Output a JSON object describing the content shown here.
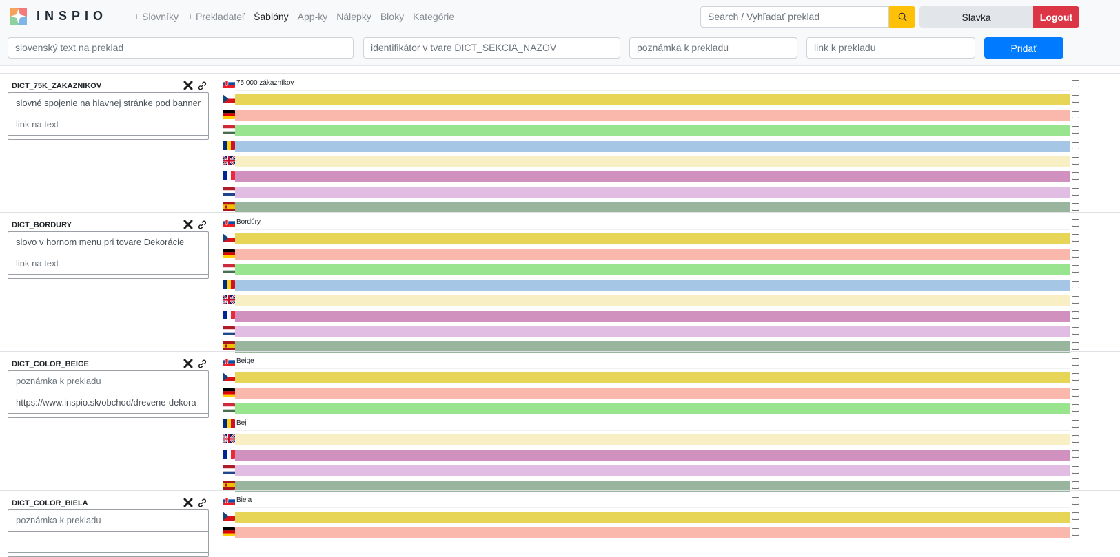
{
  "app": {
    "logo_text": "INSPIO",
    "nav": [
      {
        "label": "+ Slovníky",
        "active": false
      },
      {
        "label": "+ Prekladateľ",
        "active": false
      },
      {
        "label": "Šablóny",
        "active": true
      },
      {
        "label": "App-ky",
        "active": false
      },
      {
        "label": "Nálepky",
        "active": false
      },
      {
        "label": "Bloky",
        "active": false
      },
      {
        "label": "Kategórie",
        "active": false
      }
    ],
    "search_placeholder": "Search / Vyhľadať preklad",
    "user_label": "Slavka",
    "logout_label": "Logout"
  },
  "add_form": {
    "text_placeholder": "slovenský text na preklad",
    "id_placeholder": "identifikátor v tvare DICT_SEKCIA_NAZOV",
    "note_placeholder": "poznámka k prekladu",
    "link_placeholder": "link k prekladu",
    "submit_label": "Pridať"
  },
  "languages": [
    "sk",
    "cz",
    "de",
    "hu",
    "ro",
    "gb",
    "fr",
    "nl",
    "es"
  ],
  "lang_colors": {
    "sk": "#ffffff",
    "cz": "#e6d557",
    "de": "#f9b8ab",
    "hu": "#98e48f",
    "ro": "#a5c7e5",
    "gb": "#f8efc5",
    "fr": "#d191bf",
    "nl": "#e2bde3",
    "es": "#9ab59d"
  },
  "entries": [
    {
      "key": "DICT_75K_ZAKAZNIKOV",
      "note": "slovné spojenie na hlavnej stránke pod banner",
      "link": "link na text",
      "note_is_placeholder": false,
      "link_is_placeholder": true,
      "translations": {
        "sk": "75.000 zákazníkov"
      }
    },
    {
      "key": "DICT_BORDURY",
      "note": "slovo v hornom menu pri tovare Dekorácie",
      "link": "link na text",
      "note_is_placeholder": false,
      "link_is_placeholder": true,
      "translations": {
        "sk": "Bordúry"
      }
    },
    {
      "key": "DICT_COLOR_BEIGE",
      "note": "poznámka k prekladu",
      "link": "https://www.inspio.sk/obchod/drevene-dekora",
      "note_is_placeholder": true,
      "link_is_placeholder": false,
      "translations": {
        "sk": "Beige",
        "ro": "Bej"
      }
    },
    {
      "key": "DICT_COLOR_BIELA",
      "note": "poznámka k prekladu",
      "link": "",
      "note_is_placeholder": true,
      "link_is_placeholder": true,
      "translations": {
        "sk": "Biela"
      }
    }
  ]
}
